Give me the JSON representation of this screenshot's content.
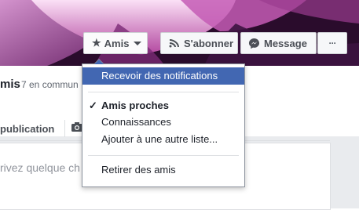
{
  "profile": {
    "friends_label": "mis",
    "common_count": "7 en commun"
  },
  "composer": {
    "tab_label": "publication",
    "placeholder_text": "rivez quelque ch"
  },
  "actions": {
    "friends_button": "Amis",
    "follow_button": "S'abonner",
    "message_button": "Message",
    "more_button": "···"
  },
  "dropdown": {
    "items": [
      {
        "label": "Recevoir des notifications",
        "state": "highlighted"
      },
      {
        "label": "Amis proches",
        "state": "checked"
      },
      {
        "label": "Connaissances",
        "state": "normal"
      },
      {
        "label": "Ajouter à une autre liste...",
        "state": "normal"
      },
      {
        "label": "Retirer des amis",
        "state": "normal"
      }
    ]
  },
  "colors": {
    "highlight": "#4267b2",
    "text": "#1d2129",
    "button_bg": "#f6f7f9"
  },
  "icons": [
    "star-icon",
    "caret-down-icon",
    "follow-icon",
    "messenger-icon",
    "more-icon",
    "camera-icon",
    "check-icon"
  ]
}
